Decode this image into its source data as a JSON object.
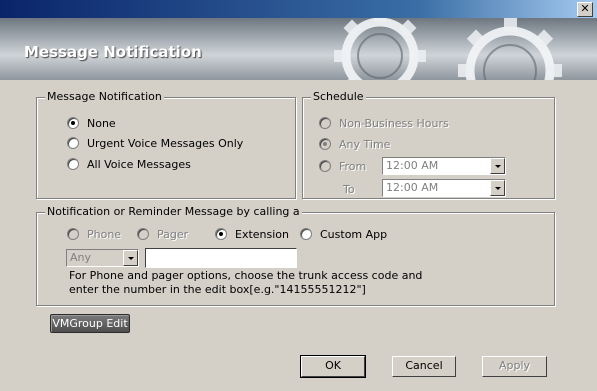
{
  "window": {
    "close_glyph": "✕"
  },
  "banner": {
    "title": "Message Notification"
  },
  "message_notification_group": {
    "title": "Message Notification",
    "options": [
      {
        "label": "None",
        "checked": true
      },
      {
        "label": "Urgent Voice Messages Only",
        "checked": false
      },
      {
        "label": "All Voice Messages",
        "checked": false
      }
    ]
  },
  "schedule_group": {
    "title": "Schedule",
    "non_business_hours": "Non-Business Hours",
    "any_time": "Any Time",
    "from_label": "From",
    "to_label": "To",
    "from_value": "12:00 AM",
    "to_value": "12:00 AM"
  },
  "notification_method_group": {
    "title": "Notification or Reminder Message  by calling a",
    "phone": "Phone",
    "pager": "Pager",
    "extension": "Extension",
    "custom_app": "Custom App",
    "trunk_code_value": "Any",
    "number_value": "",
    "help_line1": "For Phone and pager options, choose the trunk access code and",
    "help_line2": "enter the number in the edit box[e.g.\"14155551212\"]"
  },
  "buttons": {
    "vmgroup_edit": "VMGroup Edit",
    "ok": "OK",
    "cancel": "Cancel",
    "apply": "Apply"
  }
}
